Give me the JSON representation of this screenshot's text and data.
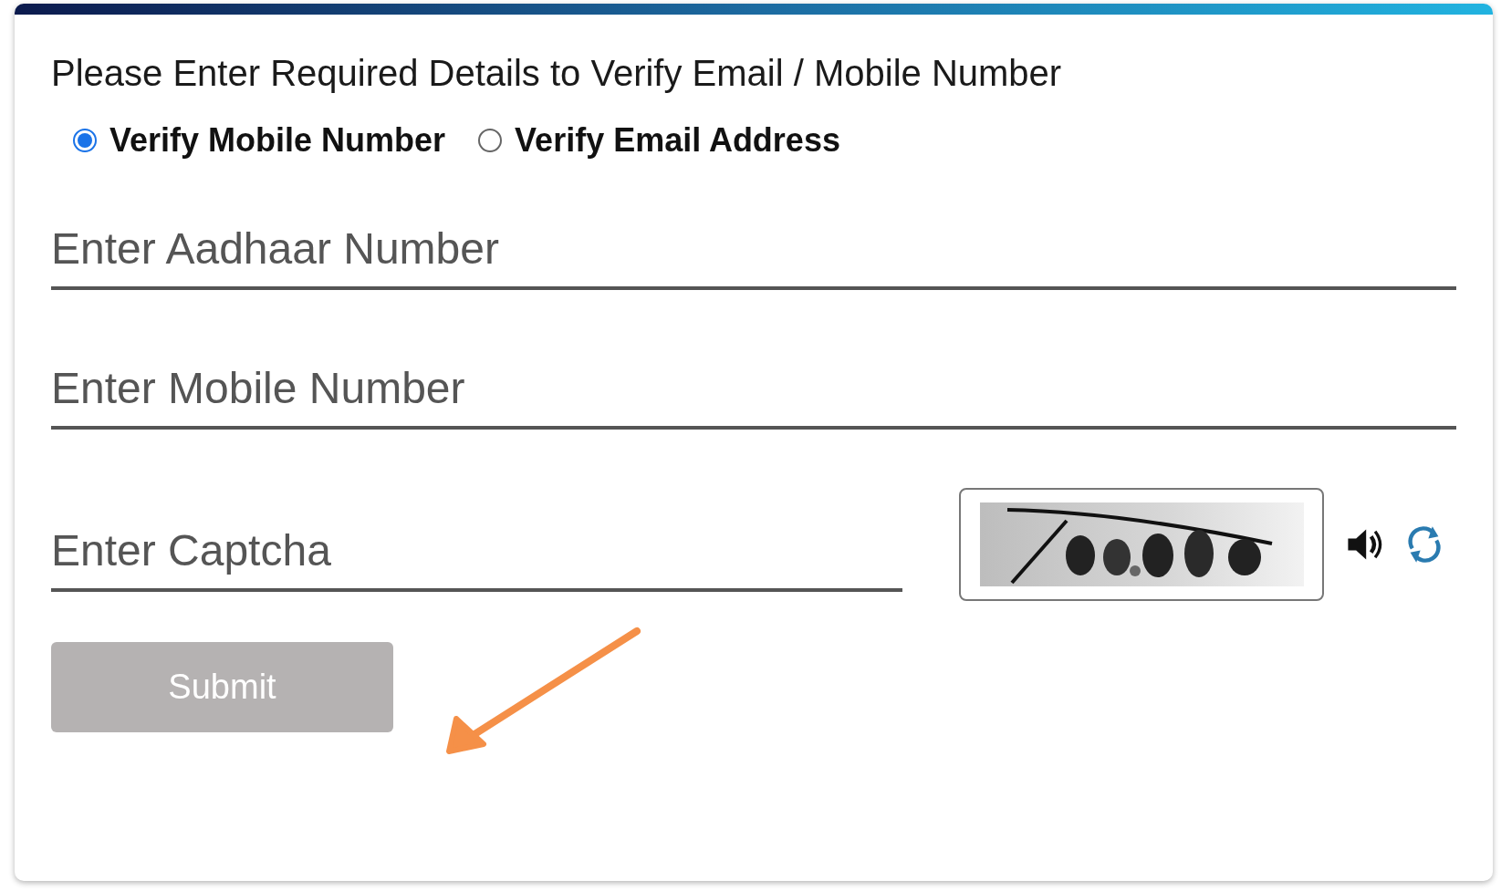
{
  "heading": "Please Enter Required Details to Verify Email / Mobile Number",
  "verify_options": [
    {
      "label": "Verify Mobile Number",
      "selected": true
    },
    {
      "label": "Verify Email Address",
      "selected": false
    }
  ],
  "fields": [
    {
      "placeholder": "Enter Aadhaar Number"
    },
    {
      "placeholder": "Enter Mobile Number"
    }
  ],
  "captcha": {
    "placeholder": "Enter Captcha"
  },
  "submit": {
    "label": "Submit",
    "disabled": true
  }
}
